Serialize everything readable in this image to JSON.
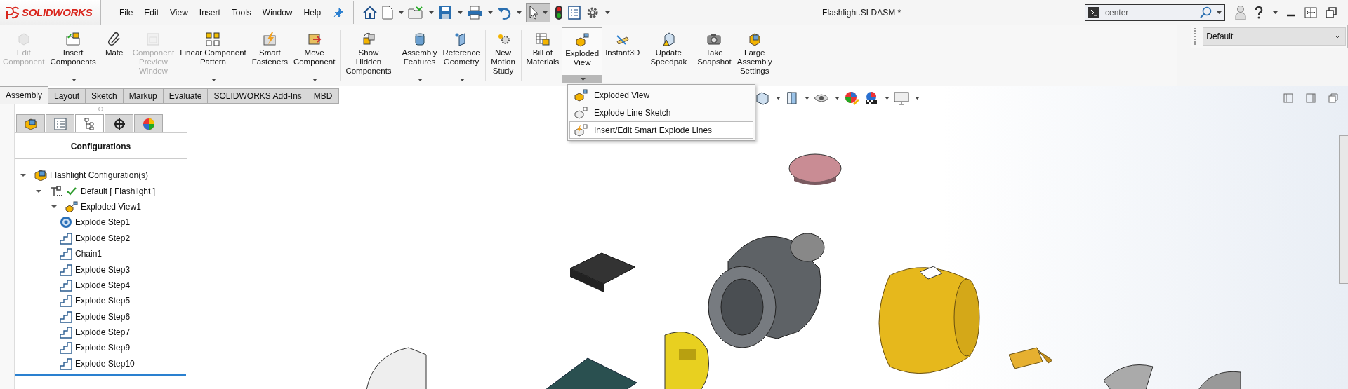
{
  "app": {
    "logo": "SOLIDWORKS"
  },
  "menu": [
    "File",
    "Edit",
    "View",
    "Insert",
    "Tools",
    "Window",
    "Help"
  ],
  "quick_access": {
    "select_active": true
  },
  "title": "Flashlight.SLDASM *",
  "search": {
    "value": "center"
  },
  "configuration_select": {
    "value": "Default"
  },
  "ribbon": {
    "groups": [
      {
        "items": [
          {
            "label": "Edit\nComponent",
            "disabled": true,
            "dropdown": false,
            "open": false
          },
          {
            "label": "Insert\nComponents",
            "disabled": false,
            "dropdown": true,
            "open": false
          },
          {
            "label": "Mate",
            "disabled": false,
            "dropdown": false,
            "open": false
          },
          {
            "label": "Component\nPreview\nWindow",
            "disabled": true,
            "dropdown": false,
            "open": false
          },
          {
            "label": "Linear Component\nPattern",
            "disabled": false,
            "dropdown": true,
            "open": false
          },
          {
            "label": "Smart\nFasteners",
            "disabled": false,
            "dropdown": false,
            "open": false
          },
          {
            "label": "Move\nComponent",
            "disabled": false,
            "dropdown": true,
            "open": false
          }
        ]
      },
      {
        "items": [
          {
            "label": "Show\nHidden\nComponents",
            "disabled": false,
            "dropdown": false,
            "open": false
          }
        ]
      },
      {
        "items": [
          {
            "label": "Assembly\nFeatures",
            "disabled": false,
            "dropdown": true,
            "open": false
          },
          {
            "label": "Reference\nGeometry",
            "disabled": false,
            "dropdown": true,
            "open": false
          }
        ]
      },
      {
        "items": [
          {
            "label": "New\nMotion\nStudy",
            "disabled": false,
            "dropdown": false,
            "open": false
          }
        ]
      },
      {
        "items": [
          {
            "label": "Bill of\nMaterials",
            "disabled": false,
            "dropdown": false,
            "open": false
          },
          {
            "label": "Exploded\nView",
            "disabled": false,
            "dropdown": true,
            "open": true
          },
          {
            "label": "Instant3D",
            "disabled": false,
            "dropdown": false,
            "open": false
          }
        ]
      },
      {
        "items": [
          {
            "label": "Update\nSpeedpak",
            "disabled": false,
            "dropdown": false,
            "open": false
          }
        ]
      },
      {
        "items": [
          {
            "label": "Take\nSnapshot",
            "disabled": false,
            "dropdown": false,
            "open": false
          },
          {
            "label": "Large\nAssembly\nSettings",
            "disabled": false,
            "dropdown": false,
            "open": false
          }
        ]
      }
    ]
  },
  "command_tabs": [
    {
      "label": "Assembly",
      "selected": true
    },
    {
      "label": "Layout",
      "selected": false
    },
    {
      "label": "Sketch",
      "selected": false
    },
    {
      "label": "Markup",
      "selected": false
    },
    {
      "label": "Evaluate",
      "selected": false
    },
    {
      "label": "SOLIDWORKS Add-Ins",
      "selected": false
    },
    {
      "label": "MBD",
      "selected": false
    }
  ],
  "dropdown_menu": [
    {
      "label": "Exploded View",
      "highlighted": false
    },
    {
      "label": "Explode Line Sketch",
      "highlighted": false
    },
    {
      "label": "Insert/Edit Smart Explode Lines",
      "highlighted": true
    }
  ],
  "panel_tabs": [
    {
      "selected": false
    },
    {
      "selected": false
    },
    {
      "selected": true
    },
    {
      "selected": false
    },
    {
      "selected": false
    }
  ],
  "tree": {
    "title": "Configurations",
    "nodes": [
      {
        "kind": "configurations",
        "label": "Flashlight Configuration(s)",
        "expanded": true,
        "children": [
          {
            "kind": "configuration",
            "label": "Default [ Flashlight ]",
            "active": true,
            "expanded": true,
            "children": [
              {
                "kind": "exploded-view",
                "label": "Exploded View1",
                "expanded": true,
                "children": [
                  {
                    "kind": "radial-step",
                    "label": "Explode Step1"
                  },
                  {
                    "kind": "step",
                    "label": "Explode Step2"
                  },
                  {
                    "kind": "step",
                    "label": "Chain1"
                  },
                  {
                    "kind": "step",
                    "label": "Explode Step3"
                  },
                  {
                    "kind": "step",
                    "label": "Explode Step4"
                  },
                  {
                    "kind": "step",
                    "label": "Explode Step5"
                  },
                  {
                    "kind": "step",
                    "label": "Explode Step6"
                  },
                  {
                    "kind": "step",
                    "label": "Explode Step7"
                  },
                  {
                    "kind": "step",
                    "label": "Explode Step9"
                  },
                  {
                    "kind": "step",
                    "label": "Explode Step10"
                  }
                ]
              }
            ]
          }
        ]
      }
    ]
  }
}
